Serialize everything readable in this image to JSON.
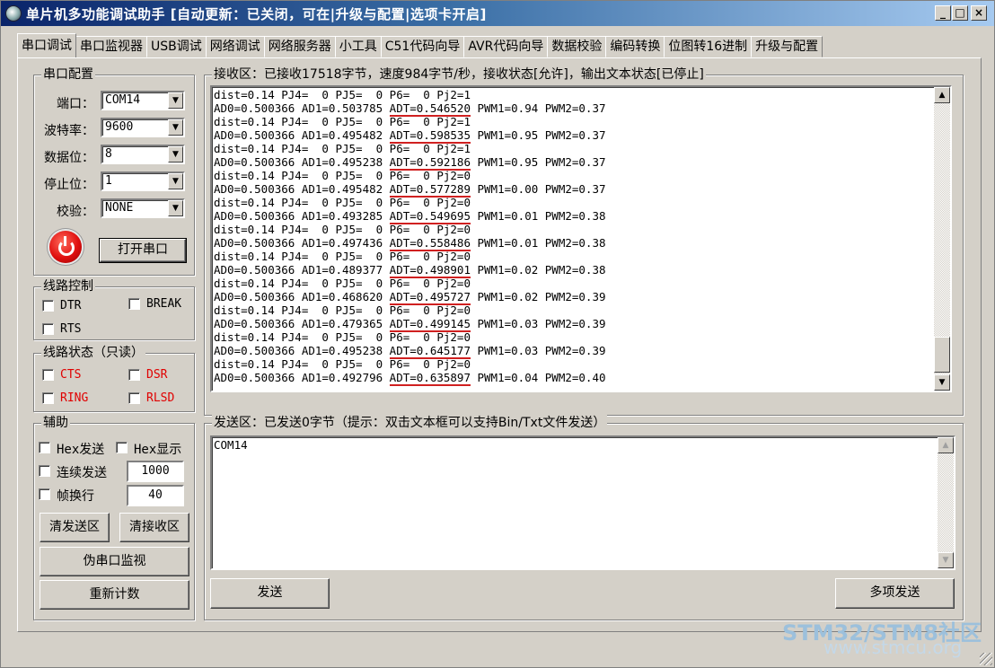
{
  "window": {
    "title": "单片机多功能调试助手 [自动更新：已关闭，可在|升级与配置|选项卡开启]",
    "minimize": "_",
    "maximize": "□",
    "close": "×"
  },
  "tabs": [
    "串口调试",
    "串口监视器",
    "USB调试",
    "网络调试",
    "网络服务器",
    "小工具",
    "C51代码向导",
    "AVR代码向导",
    "数据校验",
    "编码转换",
    "位图转16进制",
    "升级与配置"
  ],
  "serial_config": {
    "title": "串口配置",
    "port_label": "端口：",
    "port_value": "COM14",
    "baud_label": "波特率：",
    "baud_value": "9600",
    "databits_label": "数据位：",
    "databits_value": "8",
    "stopbits_label": "停止位：",
    "stopbits_value": "1",
    "parity_label": "校验：",
    "parity_value": "NONE",
    "open_button": "打开串口"
  },
  "line_control": {
    "title": "线路控制",
    "dtr": "DTR",
    "break": "BREAK",
    "rts": "RTS"
  },
  "line_status": {
    "title": "线路状态（只读）",
    "cts": "CTS",
    "dsr": "DSR",
    "ring": "RING",
    "rlsd": "RLSD",
    "indicator_color": "#e00000"
  },
  "aux": {
    "title": "辅助",
    "hex_send": "Hex发送",
    "hex_display": "Hex显示",
    "continuous_send": "连续发送",
    "continuous_value": "1000",
    "frame_newline": "帧换行",
    "frame_value": "40",
    "clear_send": "清发送区",
    "clear_receive": "清接收区",
    "fake_monitor": "伪串口监视",
    "recount": "重新计数"
  },
  "receive": {
    "title": "接收区：已接收17518字节，速度984字节/秒，接收状态[允许]，输出文本状态[已停止]",
    "lines": [
      {
        "pre": "dist=0.14 PJ4=  0 PJ5=  0 P6=  0 Pj2=1",
        "ul": "",
        "post": ""
      },
      {
        "pre": "AD0=0.500366 AD1=0.503785 ",
        "ul": "ADT=0.546520",
        "post": " PWM1=0.94 PWM2=0.37"
      },
      {
        "pre": "dist=0.14 PJ4=  0 PJ5=  0 P6=  0 Pj2=1",
        "ul": "",
        "post": ""
      },
      {
        "pre": "AD0=0.500366 AD1=0.495482 ",
        "ul": "ADT=0.598535",
        "post": " PWM1=0.95 PWM2=0.37"
      },
      {
        "pre": "dist=0.14 PJ4=  0 PJ5=  0 P6=  0 Pj2=1",
        "ul": "",
        "post": ""
      },
      {
        "pre": "AD0=0.500366 AD1=0.495238 ",
        "ul": "ADT=0.592186",
        "post": " PWM1=0.95 PWM2=0.37"
      },
      {
        "pre": "dist=0.14 PJ4=  0 PJ5=  0 P6=  0 Pj2=0",
        "ul": "",
        "post": ""
      },
      {
        "pre": "AD0=0.500366 AD1=0.495482 ",
        "ul": "ADT=0.577289",
        "post": " PWM1=0.00 PWM2=0.37"
      },
      {
        "pre": "dist=0.14 PJ4=  0 PJ5=  0 P6=  0 Pj2=0",
        "ul": "",
        "post": ""
      },
      {
        "pre": "AD0=0.500366 AD1=0.493285 ",
        "ul": "ADT=0.549695",
        "post": " PWM1=0.01 PWM2=0.38"
      },
      {
        "pre": "dist=0.14 PJ4=  0 PJ5=  0 P6=  0 Pj2=0",
        "ul": "",
        "post": ""
      },
      {
        "pre": "AD0=0.500366 AD1=0.497436 ",
        "ul": "ADT=0.558486",
        "post": " PWM1=0.01 PWM2=0.38"
      },
      {
        "pre": "dist=0.14 PJ4=  0 PJ5=  0 P6=  0 Pj2=0",
        "ul": "",
        "post": ""
      },
      {
        "pre": "AD0=0.500366 AD1=0.489377 ",
        "ul": "ADT=0.498901",
        "post": " PWM1=0.02 PWM2=0.38"
      },
      {
        "pre": "dist=0.14 PJ4=  0 PJ5=  0 P6=  0 Pj2=0",
        "ul": "",
        "post": ""
      },
      {
        "pre": "AD0=0.500366 AD1=0.468620 ",
        "ul": "ADT=0.495727",
        "post": " PWM1=0.02 PWM2=0.39"
      },
      {
        "pre": "dist=0.14 PJ4=  0 PJ5=  0 P6=  0 Pj2=0",
        "ul": "",
        "post": ""
      },
      {
        "pre": "AD0=0.500366 AD1=0.479365 ",
        "ul": "ADT=0.499145",
        "post": " PWM1=0.03 PWM2=0.39"
      },
      {
        "pre": "dist=0.14 PJ4=  0 PJ5=  0 P6=  0 Pj2=0",
        "ul": "",
        "post": ""
      },
      {
        "pre": "AD0=0.500366 AD1=0.495238 ",
        "ul": "ADT=0.645177",
        "post": " PWM1=0.03 PWM2=0.39"
      },
      {
        "pre": "dist=0.14 PJ4=  0 PJ5=  0 P6=  0 Pj2=0",
        "ul": "",
        "post": ""
      },
      {
        "pre": "AD0=0.500366 AD1=0.492796 ",
        "ul": "ADT=0.635897",
        "post": " PWM1=0.04 PWM2=0.40"
      }
    ],
    "underline_color": "#d02020"
  },
  "send": {
    "title": "发送区：已发送0字节（提示：双击文本框可以支持Bin/Txt文件发送）",
    "content": "COM14",
    "send_button": "发送",
    "multi_send_button": "多项发送"
  },
  "watermark": {
    "logo": "STM32/STM8社区",
    "url": "www.stmcu.org"
  }
}
